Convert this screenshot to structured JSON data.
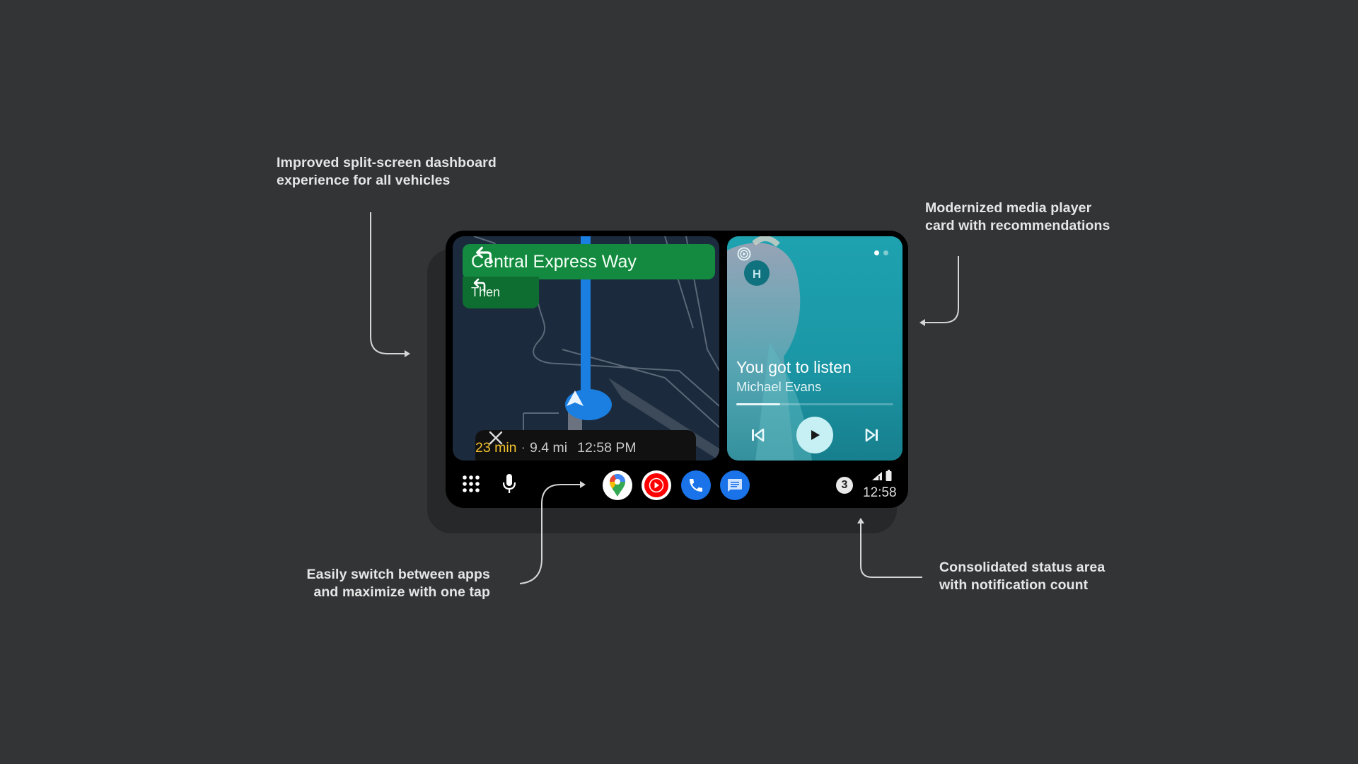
{
  "annotations": {
    "split_screen": {
      "line1": "Improved split-screen dashboard",
      "line2": "experience for all vehicles"
    },
    "media_player": {
      "line1": "Modernized media player",
      "line2": "card with recommendations"
    },
    "app_switch": {
      "line1": "Easily switch between apps",
      "line2": "and maximize with one tap"
    },
    "status_area": {
      "line1": "Consolidated status area",
      "line2": "with notification count"
    }
  },
  "navigation": {
    "turn_icon": "turn-left-icon",
    "street": "Central Express Way",
    "then_label": "Then",
    "then_icon": "turn-left-icon",
    "eta_minutes": "23 min",
    "separator": "·",
    "distance": "9.4 mi",
    "arrival_time": "12:58 PM",
    "colors": {
      "turn_card": "#138a3f",
      "route": "#1a7fe0",
      "eta": "#f2c12e"
    }
  },
  "media": {
    "source_icon": "media-source-icon",
    "page_count": 2,
    "current_page": 1,
    "title": "You got to listen",
    "artist": "Michael Evans",
    "progress_fraction": 0.28,
    "headphone_letter": "H",
    "controls": {
      "prev": "skip-previous-icon",
      "play": "play-icon",
      "next": "skip-next-icon"
    },
    "accent": "#1ea2b0"
  },
  "dock": {
    "launcher_icon": "app-launcher-icon",
    "mic_icon": "microphone-icon",
    "apps": [
      {
        "name": "Google Maps",
        "icon": "maps-icon"
      },
      {
        "name": "YouTube Music",
        "icon": "youtube-music-icon"
      },
      {
        "name": "Phone",
        "icon": "phone-icon"
      },
      {
        "name": "Messages",
        "icon": "messages-icon"
      }
    ],
    "notification_count": "3",
    "clock": "12:58"
  }
}
